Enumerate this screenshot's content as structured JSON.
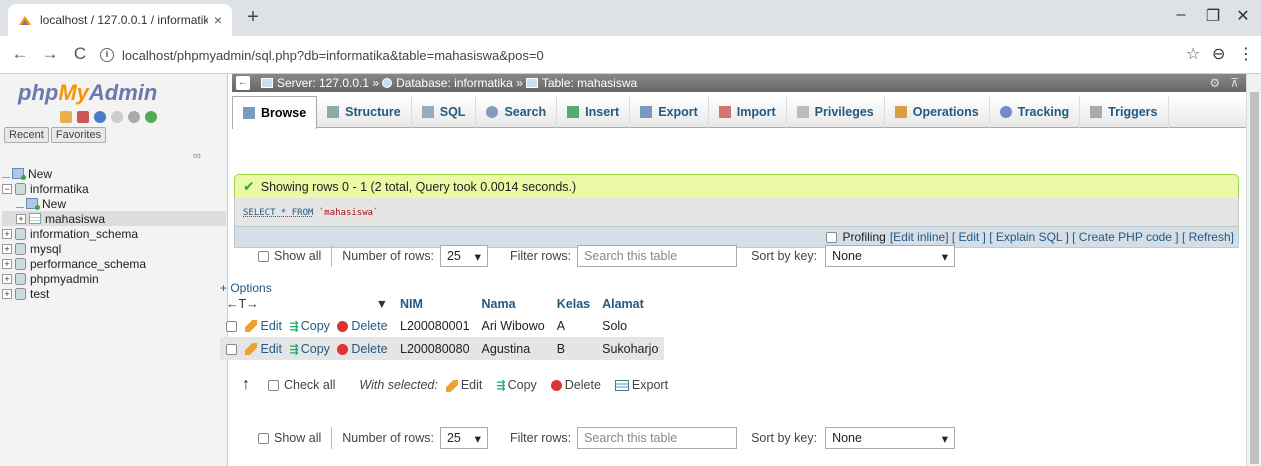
{
  "browser": {
    "tab_title": "localhost / 127.0.0.1 / informatika",
    "tab_close": "×",
    "new_tab": "+",
    "url": "localhost/phpmyadmin/sql.php?db=informatika&table=mahasiswa&pos=0",
    "minimize": "–",
    "maximize": "❐",
    "close": "✕",
    "back": "←",
    "forward": "→",
    "reload": "C",
    "info": "i",
    "star": "☆",
    "profile": "⊖",
    "menu": "⋮"
  },
  "sidebar": {
    "logo_php": "php",
    "logo_my": "My",
    "logo_admin": "Admin",
    "recent_tab": "Recent",
    "favorites_tab": "Favorites",
    "link_icon": "∞",
    "tree": [
      {
        "label": "New"
      },
      {
        "label": "informatika"
      },
      {
        "label": "New"
      },
      {
        "label": "mahasiswa"
      },
      {
        "label": "information_schema"
      },
      {
        "label": "mysql"
      },
      {
        "label": "performance_schema"
      },
      {
        "label": "phpmyadmin"
      },
      {
        "label": "test"
      }
    ]
  },
  "breadcrumb": {
    "server": "Server: 127.0.0.1 »",
    "database": "Database: informatika »",
    "table": "Table: mahasiswa",
    "gear": "⚙",
    "collapse": "⊼"
  },
  "tabs": [
    {
      "label": "Browse",
      "icon_color": "#7a9cc0"
    },
    {
      "label": "Structure",
      "icon_color": "#8aa"
    },
    {
      "label": "SQL",
      "icon_color": "#9ab"
    },
    {
      "label": "Search",
      "icon_color": "#89b"
    },
    {
      "label": "Insert",
      "icon_color": "#5a7"
    },
    {
      "label": "Export",
      "icon_color": "#79b"
    },
    {
      "label": "Import",
      "icon_color": "#c77"
    },
    {
      "label": "Privileges",
      "icon_color": "#bbb"
    },
    {
      "label": "Operations",
      "icon_color": "#d8a040"
    },
    {
      "label": "Tracking",
      "icon_color": "#78c"
    },
    {
      "label": "Triggers",
      "icon_color": "#aaa"
    }
  ],
  "message": {
    "success": "Showing rows 0 - 1 (2 total, Query took 0.0014 seconds.)",
    "sql_kw": "SELECT * FROM",
    "sql_table": "`mahasiswa`"
  },
  "profiling": {
    "label": "Profiling",
    "links": "[Edit inline] [ Edit ] [ Explain SQL ] [ Create PHP code ] [ Refresh]"
  },
  "nav": {
    "show_all": "Show all",
    "rows_label": "Number of rows:",
    "rows_value": "25",
    "filter_label": "Filter rows:",
    "filter_placeholder": "Search this table",
    "sort_label": "Sort by key:",
    "sort_value": "None",
    "caret": "▾"
  },
  "table": {
    "options_link": "+ Options",
    "arrows": "←T→",
    "sort_caret": "▼",
    "columns": [
      "NIM",
      "Nama",
      "Kelas",
      "Alamat"
    ],
    "edit": "Edit",
    "copy": "Copy",
    "delete": "Delete",
    "copy_icon": "⇶",
    "rows": [
      {
        "nim": "L200080001",
        "nama": "Ari Wibowo",
        "kelas": "A",
        "alamat": "Solo"
      },
      {
        "nim": "L200080080",
        "nama": "Agustina",
        "kelas": "B",
        "alamat": "Sukoharjo"
      }
    ]
  },
  "bulk": {
    "arrow": "↑",
    "check_all": "Check all",
    "with_selected": "With selected:",
    "edit": "Edit",
    "copy": "Copy",
    "delete": "Delete",
    "export": "Export"
  }
}
